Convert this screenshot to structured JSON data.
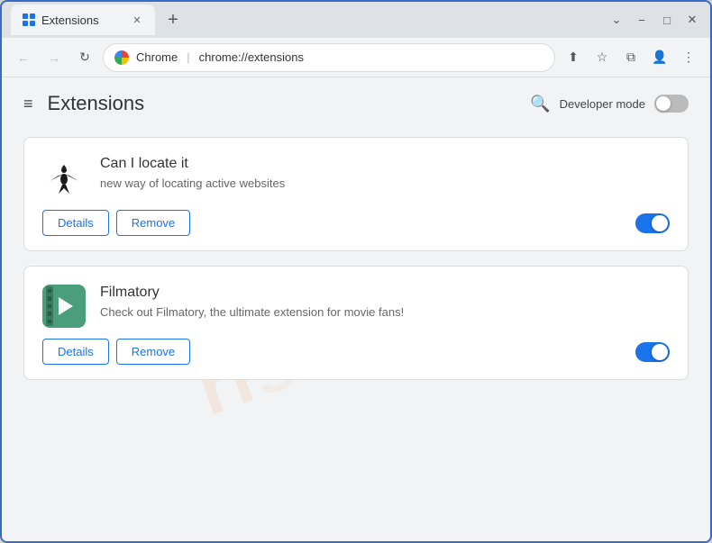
{
  "window": {
    "title": "Extensions",
    "tab_label": "Extensions",
    "close_symbol": "✕",
    "new_tab_symbol": "+",
    "minimize_symbol": "−",
    "maximize_symbol": "□",
    "close_win_symbol": "✕"
  },
  "nav": {
    "back_symbol": "←",
    "forward_symbol": "→",
    "refresh_symbol": "↻",
    "chrome_label": "Chrome",
    "url": "chrome://extensions",
    "share_symbol": "⬆",
    "star_symbol": "☆",
    "extensions_symbol": "⧉",
    "profile_symbol": "👤",
    "menu_symbol": "⋮"
  },
  "header": {
    "hamburger_symbol": "≡",
    "title": "Extensions",
    "search_symbol": "🔍",
    "dev_mode_label": "Developer mode"
  },
  "extensions": [
    {
      "name": "Can I locate it",
      "description": "new way of locating active websites",
      "details_label": "Details",
      "remove_label": "Remove",
      "enabled": true
    },
    {
      "name": "Filmatory",
      "description": "Check out Filmatory, the ultimate extension for movie fans!",
      "details_label": "Details",
      "remove_label": "Remove",
      "enabled": true
    }
  ],
  "watermark": {
    "text": "ri sh.com"
  },
  "colors": {
    "accent": "#1a73e8",
    "toggle_on": "#1a73e8",
    "border": "#dadce0"
  }
}
